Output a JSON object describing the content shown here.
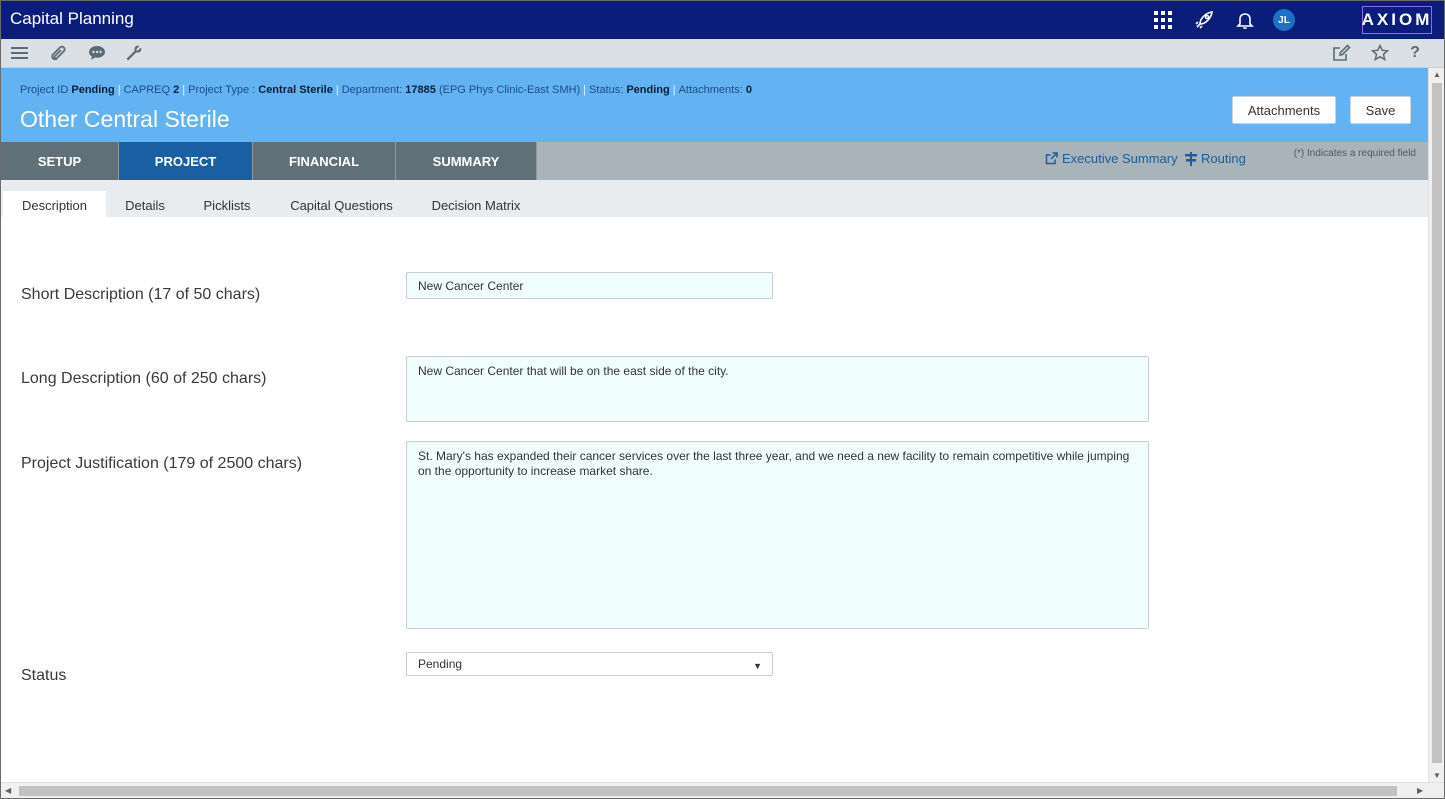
{
  "app": {
    "title": "Capital Planning",
    "brand": "AXIOM",
    "user_initials": "JL"
  },
  "top_icons": [
    "apps-grid-icon",
    "rocket-icon",
    "bell-icon"
  ],
  "toolbar": {
    "left_icons": [
      "menu-icon",
      "paperclip-icon",
      "chat-icon",
      "wrench-icon"
    ],
    "right_icons": [
      "edit-icon",
      "star-icon",
      "help-icon"
    ]
  },
  "project": {
    "meta": {
      "id_label": "Project ID",
      "id_value": "Pending",
      "capreq_label": "CAPREQ",
      "capreq_value": "2",
      "type_label": "Project Type :",
      "type_value": "Central Sterile",
      "dept_label": "Department:",
      "dept_value": "17885",
      "dept_name": "(EPG Phys Clinic-East SMH)",
      "status_label": "Status:",
      "status_value": "Pending",
      "attach_label": "Attachments:",
      "attach_value": "0",
      "separator": "|"
    },
    "title": "Other Central Sterile",
    "attachments_button": "Attachments",
    "save_button": "Save"
  },
  "main_tabs": [
    {
      "label": "SETUP"
    },
    {
      "label": "PROJECT"
    },
    {
      "label": "FINANCIAL"
    },
    {
      "label": "SUMMARY"
    }
  ],
  "links": {
    "executive_summary": "Executive Summary",
    "routing": "Routing"
  },
  "required_note": "(*) Indicates a required field",
  "sub_tabs": [
    {
      "label": "Description"
    },
    {
      "label": "Details"
    },
    {
      "label": "Picklists"
    },
    {
      "label": "Capital Questions"
    },
    {
      "label": "Decision Matrix"
    }
  ],
  "form": {
    "short_description": {
      "label": "Short Description (17 of 50 chars)",
      "value": "New Cancer Center"
    },
    "long_description": {
      "label": "Long Description (60 of 250 chars)",
      "value": "New Cancer Center that will be on the east side of the city."
    },
    "justification": {
      "label": "Project Justification (179 of 2500 chars)",
      "value": "St. Mary's has expanded their cancer services over the last three year, and we need a new facility to remain competitive while jumping on the opportunity to increase market share."
    },
    "status": {
      "label": "Status",
      "value": "Pending"
    }
  },
  "colors": {
    "topbar": "#0b1d7a",
    "header": "#63b2f1",
    "tab_active": "#1a5fa2",
    "tab_inactive": "#5f7078",
    "link": "#1b5d9e",
    "input_bg": "#f0fefe"
  }
}
